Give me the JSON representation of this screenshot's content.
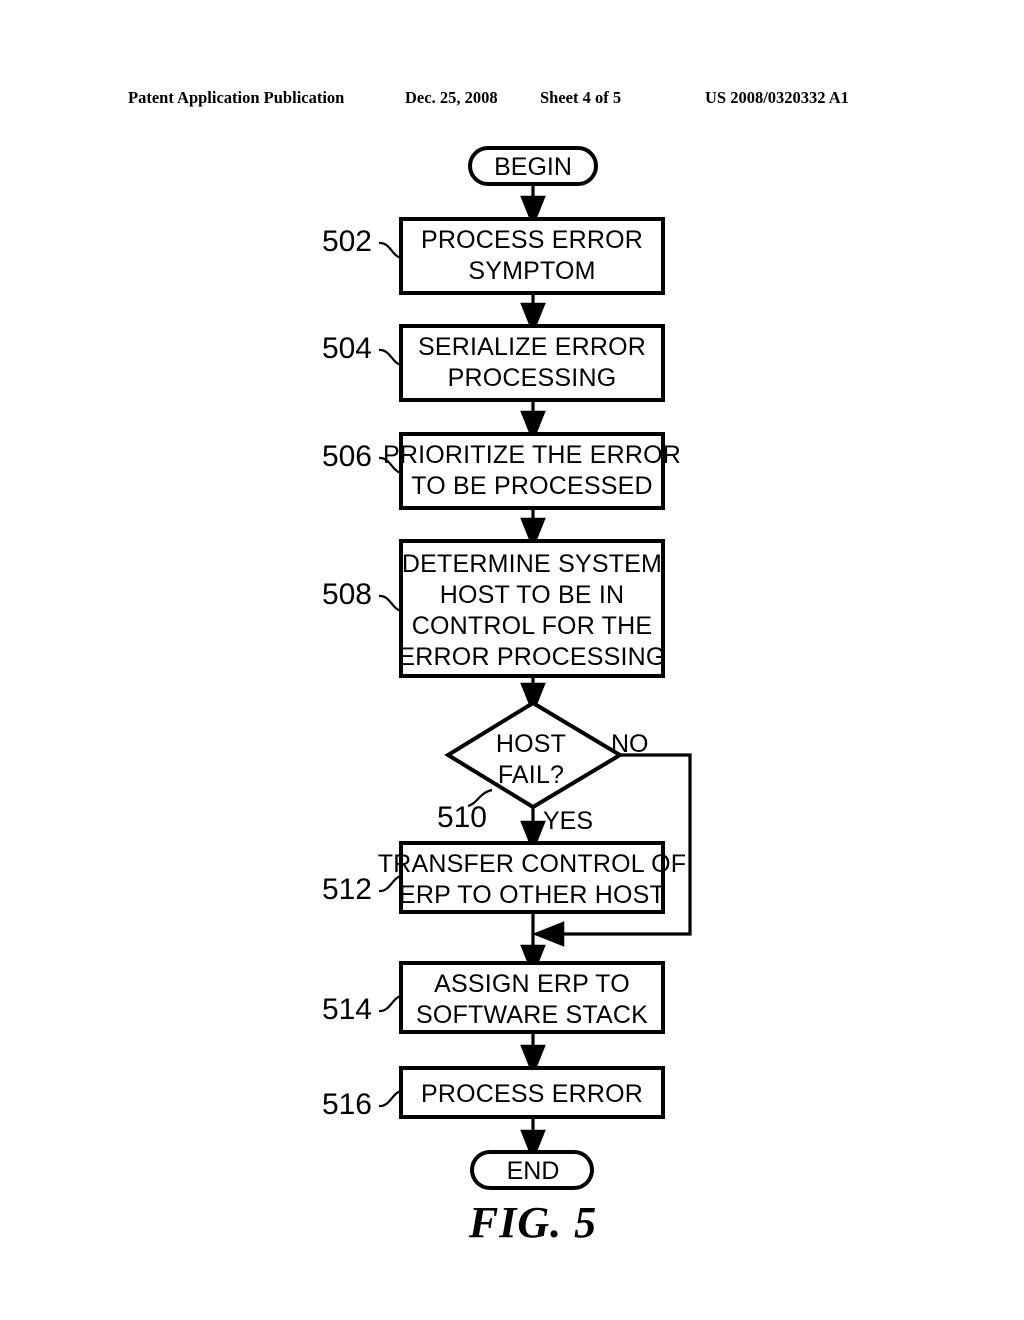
{
  "header": {
    "publication": "Patent Application Publication",
    "date": "Dec. 25, 2008",
    "sheet": "Sheet 4 of 5",
    "patent_number": "US 2008/0320332 A1"
  },
  "figure": {
    "caption": "FIG. 5",
    "start_label": "BEGIN",
    "end_label": "END",
    "branch_yes": "YES",
    "branch_no": "NO",
    "nodes": [
      {
        "ref": "502",
        "lines": [
          "PROCESS ERROR",
          "SYMPTOM"
        ]
      },
      {
        "ref": "504",
        "lines": [
          "SERIALIZE ERROR",
          "PROCESSING"
        ]
      },
      {
        "ref": "506",
        "lines": [
          "PRIORITIZE THE ERROR",
          "TO BE PROCESSED"
        ]
      },
      {
        "ref": "508",
        "lines": [
          "DETERMINE SYSTEM",
          "HOST TO BE IN",
          "CONTROL FOR THE",
          "ERROR PROCESSING"
        ]
      },
      {
        "ref": "510",
        "lines": [
          "HOST",
          "FAIL?"
        ]
      },
      {
        "ref": "512",
        "lines": [
          "TRANSFER CONTROL OF",
          "ERP TO OTHER HOST"
        ]
      },
      {
        "ref": "514",
        "lines": [
          "ASSIGN ERP TO",
          "SOFTWARE STACK"
        ]
      },
      {
        "ref": "516",
        "lines": [
          "PROCESS ERROR"
        ]
      }
    ]
  },
  "chart_data": {
    "type": "diagram",
    "title": "FIG. 5",
    "diagram_kind": "flowchart",
    "orientation": "top-to-bottom",
    "nodes": [
      {
        "id": "begin",
        "shape": "terminator",
        "text": "BEGIN"
      },
      {
        "id": "502",
        "shape": "process",
        "text": "PROCESS ERROR SYMPTOM"
      },
      {
        "id": "504",
        "shape": "process",
        "text": "SERIALIZE ERROR PROCESSING"
      },
      {
        "id": "506",
        "shape": "process",
        "text": "PRIORITIZE THE ERROR TO BE PROCESSED"
      },
      {
        "id": "508",
        "shape": "process",
        "text": "DETERMINE SYSTEM HOST TO BE IN CONTROL FOR THE ERROR PROCESSING"
      },
      {
        "id": "510",
        "shape": "decision",
        "text": "HOST FAIL?"
      },
      {
        "id": "512",
        "shape": "process",
        "text": "TRANSFER CONTROL OF ERP TO OTHER HOST"
      },
      {
        "id": "514",
        "shape": "process",
        "text": "ASSIGN ERP TO SOFTWARE STACK"
      },
      {
        "id": "516",
        "shape": "process",
        "text": "PROCESS ERROR"
      },
      {
        "id": "end",
        "shape": "terminator",
        "text": "END"
      }
    ],
    "edges": [
      {
        "from": "begin",
        "to": "502",
        "label": ""
      },
      {
        "from": "502",
        "to": "504",
        "label": ""
      },
      {
        "from": "504",
        "to": "506",
        "label": ""
      },
      {
        "from": "506",
        "to": "508",
        "label": ""
      },
      {
        "from": "508",
        "to": "510",
        "label": ""
      },
      {
        "from": "510",
        "to": "512",
        "label": "YES"
      },
      {
        "from": "510",
        "to": "514",
        "label": "NO"
      },
      {
        "from": "512",
        "to": "514",
        "label": ""
      },
      {
        "from": "514",
        "to": "516",
        "label": ""
      },
      {
        "from": "516",
        "to": "end",
        "label": ""
      }
    ]
  }
}
